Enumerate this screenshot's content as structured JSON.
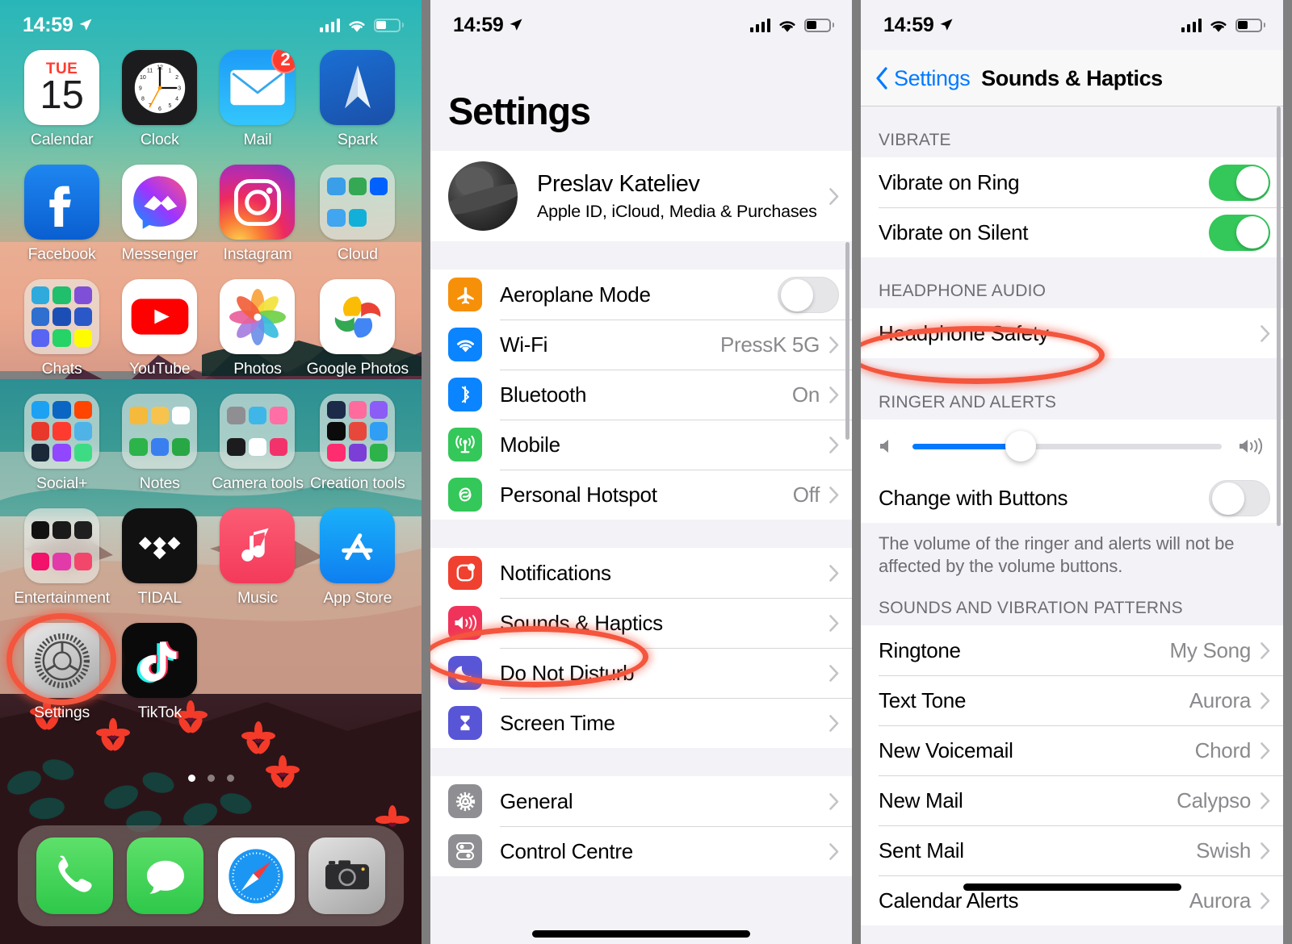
{
  "status_bar": {
    "time": "14:59",
    "location_icon": "location-arrow-icon",
    "signal_icon": "cellular-bars-icon",
    "wifi_icon": "wifi-icon",
    "battery_icon": "battery-icon"
  },
  "panel_home": {
    "name": "iOS Home Screen",
    "apps": [
      {
        "label": "Calendar",
        "type": "calendar",
        "day_name": "TUE",
        "day_num": "15"
      },
      {
        "label": "Clock",
        "type": "clock"
      },
      {
        "label": "Mail",
        "type": "mail",
        "badge": "2"
      },
      {
        "label": "Spark",
        "type": "spark"
      },
      {
        "label": "Facebook",
        "type": "facebook"
      },
      {
        "label": "Messenger",
        "type": "messenger"
      },
      {
        "label": "Instagram",
        "type": "instagram"
      },
      {
        "label": "Cloud",
        "type": "folder",
        "minis": [
          "#3a9ee8",
          "#34a853",
          "#0061ff",
          "#41a5f0",
          "#12b0d8"
        ]
      },
      {
        "label": "Chats",
        "type": "folder",
        "minis": [
          "#2eaadc",
          "#1fbf6c",
          "#7f4fd8",
          "#2f6fd0",
          "#1b4fb5",
          "#2b58c8",
          "#5865f2",
          "#25d366",
          "#fffc00"
        ]
      },
      {
        "label": "YouTube",
        "type": "youtube"
      },
      {
        "label": "Photos",
        "type": "photos"
      },
      {
        "label": "Google Photos",
        "type": "gphotos"
      },
      {
        "label": "Social+",
        "type": "folder",
        "minis": [
          "#1da1f2",
          "#0a66c2",
          "#ff4500",
          "#e8382c",
          "#ff3b30",
          "#4fb3e8",
          "#1b2838",
          "#9146ff",
          "#3ddc84"
        ]
      },
      {
        "label": "Notes",
        "type": "folder",
        "minis": [
          "#f5b93c",
          "#f7c34c",
          "#ffffff",
          "#2cb34a",
          "#3a7ff0",
          "#28a745"
        ]
      },
      {
        "label": "Camera tools",
        "type": "folder",
        "minis": [
          "#8e8e93",
          "#3fb6e8",
          "#ff6fa5",
          "#1c1c1e",
          "#ffffff",
          "#f2336b"
        ]
      },
      {
        "label": "Creation tools",
        "type": "folder",
        "minis": [
          "#1c2b4a",
          "#ff6b9d",
          "#8b5cf6",
          "#0b0b0b",
          "#e8483c",
          "#2f9ef4",
          "#ff2d6f",
          "#7b3fd8",
          "#2cb34a"
        ]
      },
      {
        "label": "Entertainment",
        "type": "folder",
        "minis": [
          "#111111",
          "#1a1a1a",
          "#1f1f1f",
          "#f2116b",
          "#e23aa8",
          "#f2476b"
        ]
      },
      {
        "label": "TIDAL",
        "type": "tidal"
      },
      {
        "label": "Music",
        "type": "music"
      },
      {
        "label": "App Store",
        "type": "appstore"
      },
      {
        "label": "Settings",
        "type": "settings",
        "highlighted": true
      },
      {
        "label": "TikTok",
        "type": "tiktok"
      }
    ],
    "page_dots": {
      "count": 3,
      "active_index": 0
    },
    "dock": [
      {
        "label": "Phone",
        "type": "phone"
      },
      {
        "label": "Messages",
        "type": "messages"
      },
      {
        "label": "Safari",
        "type": "safari"
      },
      {
        "label": "Camera",
        "type": "camera"
      }
    ],
    "highlight_target": "Settings"
  },
  "panel_settings": {
    "title": "Settings",
    "profile": {
      "name": "Preslav Kateliev",
      "subtitle": "Apple ID, iCloud, Media & Purchases"
    },
    "group_connectivity": [
      {
        "label": "Aeroplane Mode",
        "icon": "aeroplane-icon",
        "icon_color": "#f79009",
        "control": "toggle",
        "toggle_on": false
      },
      {
        "label": "Wi-Fi",
        "icon": "wifi-icon",
        "icon_color": "#0a84ff",
        "value": "PressK 5G",
        "control": "chevron"
      },
      {
        "label": "Bluetooth",
        "icon": "bluetooth-icon",
        "icon_color": "#0a84ff",
        "value": "On",
        "control": "chevron"
      },
      {
        "label": "Mobile",
        "icon": "cellular-icon",
        "icon_color": "#34c759",
        "value": "",
        "control": "chevron"
      },
      {
        "label": "Personal Hotspot",
        "icon": "hotspot-icon",
        "icon_color": "#34c759",
        "value": "Off",
        "control": "chevron"
      }
    ],
    "group_notifications": [
      {
        "label": "Notifications",
        "icon": "notifications-icon",
        "icon_color": "#f0402f",
        "value": "",
        "control": "chevron"
      },
      {
        "label": "Sounds & Haptics",
        "icon": "sounds-haptics-icon",
        "icon_color": "#f0335b",
        "value": "",
        "control": "chevron",
        "highlighted": true
      },
      {
        "label": "Do Not Disturb",
        "icon": "moon-icon",
        "icon_color": "#5856d6",
        "value": "",
        "control": "chevron"
      },
      {
        "label": "Screen Time",
        "icon": "hourglass-icon",
        "icon_color": "#5856d6",
        "value": "",
        "control": "chevron"
      }
    ],
    "group_general": [
      {
        "label": "General",
        "icon": "gear-icon",
        "icon_color": "#8e8e93",
        "value": "",
        "control": "chevron"
      },
      {
        "label": "Control Centre",
        "icon": "control-centre-icon",
        "icon_color": "#8e8e93",
        "value": "",
        "control": "chevron"
      }
    ],
    "highlight_target": "Sounds & Haptics"
  },
  "panel_sounds": {
    "nav": {
      "back_label": "Settings",
      "title": "Sounds & Haptics",
      "back_icon": "chevron-left-icon"
    },
    "section_vibrate": {
      "header": "VIBRATE",
      "rows": [
        {
          "label": "Vibrate on Ring",
          "control": "toggle",
          "toggle_on": true
        },
        {
          "label": "Vibrate on Silent",
          "control": "toggle",
          "toggle_on": true
        }
      ]
    },
    "section_headphone": {
      "header": "HEADPHONE AUDIO",
      "rows": [
        {
          "label": "Headphone Safety",
          "control": "chevron",
          "highlighted": true
        }
      ]
    },
    "section_ringer": {
      "header": "RINGER AND ALERTS",
      "slider": {
        "left_icon": "speaker-mute-icon",
        "right_icon": "speaker-loud-icon",
        "value_percent": 35
      },
      "rows": [
        {
          "label": "Change with Buttons",
          "control": "toggle",
          "toggle_on": false
        }
      ],
      "footnote": "The volume of the ringer and alerts will not be affected by the volume buttons."
    },
    "section_patterns": {
      "header": "SOUNDS AND VIBRATION PATTERNS",
      "rows": [
        {
          "label": "Ringtone",
          "value": "My Song",
          "control": "chevron"
        },
        {
          "label": "Text Tone",
          "value": "Aurora",
          "control": "chevron"
        },
        {
          "label": "New Voicemail",
          "value": "Chord",
          "control": "chevron"
        },
        {
          "label": "New Mail",
          "value": "Calypso",
          "control": "chevron"
        },
        {
          "label": "Sent Mail",
          "value": "Swish",
          "control": "chevron"
        },
        {
          "label": "Calendar Alerts",
          "value": "Aurora",
          "control": "chevron"
        }
      ]
    },
    "highlight_target": "Headphone Safety",
    "accent_color": "#007aff",
    "toggle_on_color": "#34c759",
    "highlight_color": "#f4553d"
  }
}
